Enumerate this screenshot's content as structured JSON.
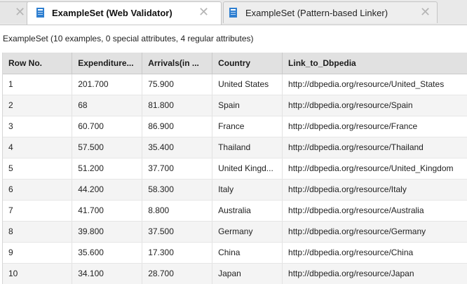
{
  "tabs": [
    {
      "label": "",
      "active": false
    },
    {
      "label": "ExampleSet (Web Validator)",
      "active": true
    },
    {
      "label": "ExampleSet (Pattern-based Linker)",
      "active": false
    }
  ],
  "summary": "ExampleSet (10 examples, 0 special attributes, 4 regular attributes)",
  "table": {
    "headers": [
      "Row No.",
      "Expenditure...",
      "Arrivals(in ...",
      "Country",
      "Link_to_Dbpedia"
    ],
    "rows": [
      [
        "1",
        "201.700",
        "75.900",
        "United States",
        "http://dbpedia.org/resource/United_States"
      ],
      [
        "2",
        "68",
        "81.800",
        "Spain",
        "http://dbpedia.org/resource/Spain"
      ],
      [
        "3",
        "60.700",
        "86.900",
        "France",
        "http://dbpedia.org/resource/France"
      ],
      [
        "4",
        "57.500",
        "35.400",
        "Thailand",
        "http://dbpedia.org/resource/Thailand"
      ],
      [
        "5",
        "51.200",
        "37.700",
        "United Kingd...",
        "http://dbpedia.org/resource/United_Kingdom"
      ],
      [
        "6",
        "44.200",
        "58.300",
        "Italy",
        "http://dbpedia.org/resource/Italy"
      ],
      [
        "7",
        "41.700",
        "8.800",
        "Australia",
        "http://dbpedia.org/resource/Australia"
      ],
      [
        "8",
        "39.800",
        "37.500",
        "Germany",
        "http://dbpedia.org/resource/Germany"
      ],
      [
        "9",
        "35.600",
        "17.300",
        "China",
        "http://dbpedia.org/resource/China"
      ],
      [
        "10",
        "34.100",
        "28.700",
        "Japan",
        "http://dbpedia.org/resource/Japan"
      ]
    ]
  },
  "icons": {
    "tab_icon": "table-icon",
    "close_icon": "close-icon"
  },
  "colors": {
    "tab_icon_blue": "#2f7fd0",
    "header_bg": "#e1e1e1",
    "alt_row_bg": "#f4f4f4"
  }
}
